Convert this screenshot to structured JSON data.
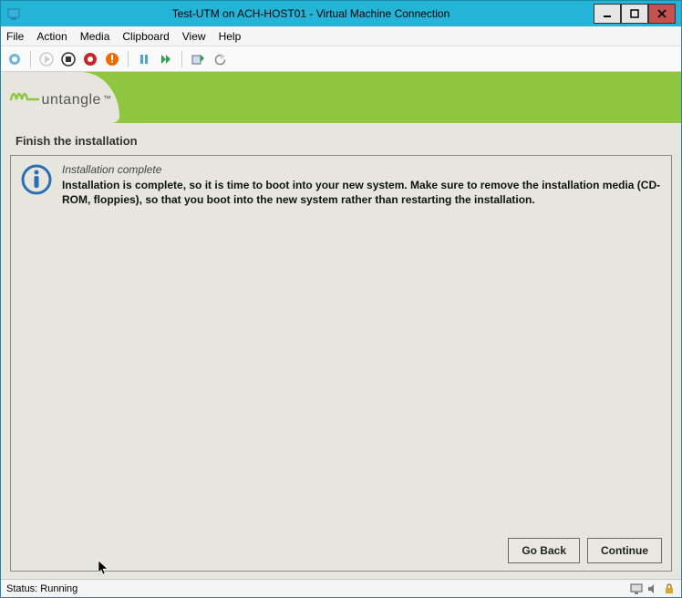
{
  "titlebar": {
    "title": "Test-UTM on ACH-HOST01 - Virtual Machine Connection"
  },
  "menubar": {
    "items": [
      "File",
      "Action",
      "Media",
      "Clipboard",
      "View",
      "Help"
    ]
  },
  "brand": {
    "name": "untangle"
  },
  "installer": {
    "section_title": "Finish the installation",
    "msg_header": "Installation complete",
    "msg_body": "Installation is complete, so it is time to boot into your new system. Make sure to remove the installation media (CD-ROM, floppies), so that you boot into the new system rather than restarting the installation.",
    "go_back_label": "Go Back",
    "continue_label": "Continue"
  },
  "statusbar": {
    "text": "Status: Running"
  },
  "icons": {
    "ctrl_alt_del": "ctrl-alt-del-icon",
    "start": "start-icon",
    "stop": "stop-icon",
    "shutdown": "shutdown-icon",
    "turnoff": "turnoff-icon",
    "pause": "pause-icon",
    "reset": "reset-icon",
    "checkpoint": "checkpoint-icon",
    "revert": "revert-icon"
  }
}
